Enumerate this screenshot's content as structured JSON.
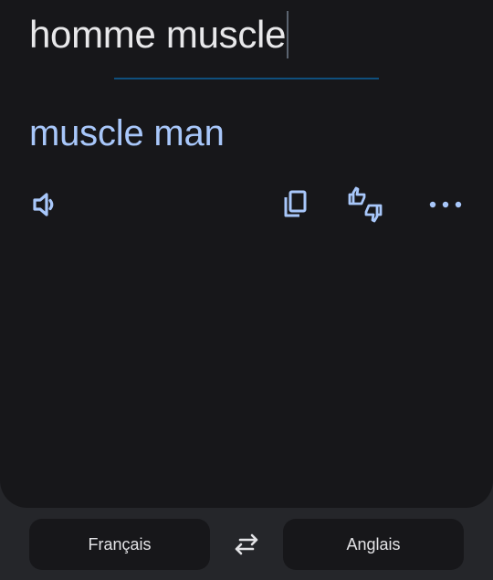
{
  "source": {
    "text": "homme muscle"
  },
  "translation": {
    "text": "muscle man"
  },
  "actions": {
    "listen_icon": "speaker-icon",
    "copy_icon": "copy-icon",
    "feedback_icon": "thumbs-up-down-icon",
    "more_icon": "more-horizontal-icon"
  },
  "languages": {
    "source_label": "Français",
    "target_label": "Anglais",
    "swap_icon": "swap-arrows-icon"
  },
  "colors": {
    "accent": "#a8c7fa",
    "card_background": "#17171a",
    "page_background": "#25262a",
    "divider": "#0f4f7d"
  }
}
